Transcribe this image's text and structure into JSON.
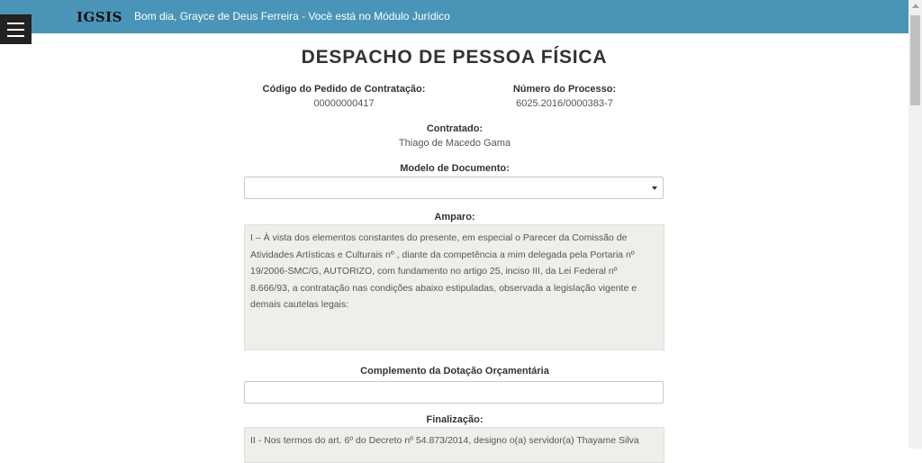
{
  "header": {
    "logo": "IGSIS",
    "greeting": "Bom dia, Grayce de Deus Ferreira - Você está no Módulo Jurídico"
  },
  "page": {
    "title": "DESPACHO DE PESSOA FÍSICA"
  },
  "fields": {
    "codigo_label": "Código do Pedido de Contratação:",
    "codigo_value": "00000000417",
    "processo_label": "Número do Processo:",
    "processo_value": "6025.2016/0000383-7",
    "contratado_label": "Contratado:",
    "contratado_value": "Thiago de Macedo Gama",
    "modelo_label": "Modelo de Documento:",
    "modelo_value": "",
    "amparo_label": "Amparo:",
    "amparo_text": " I – À vista dos elementos constantes do presente, em especial o Parecer da Comissão de Atividades Artísticas e Culturais nº , diante da competência a mim delegada pela Portaria nº 19/2006-SMC/G, AUTORIZO, com fundamento no artigo 25, inciso III, da Lei Federal nº 8.666/93, a contratação nas condições abaixo estipuladas, observada a legislação vigente e demais cautelas legais:",
    "complemento_label": "Complemento da Dotação Orçamentária",
    "complemento_value": "",
    "finalizacao_label": "Finalização:",
    "finalizacao_text": "II - Nos termos do art. 6º do Decreto nº 54.873/2014, designo o(a) servidor(a) Thayame Silva"
  },
  "icons": {
    "menu": "hamburger-menu-icon",
    "select_caret": "caret-down-icon",
    "scroll_up": "scroll-up-arrow-icon"
  },
  "colors": {
    "header_bg": "#4a94b8",
    "menu_bg": "#222222",
    "textarea_bg": "#eeeeea"
  }
}
